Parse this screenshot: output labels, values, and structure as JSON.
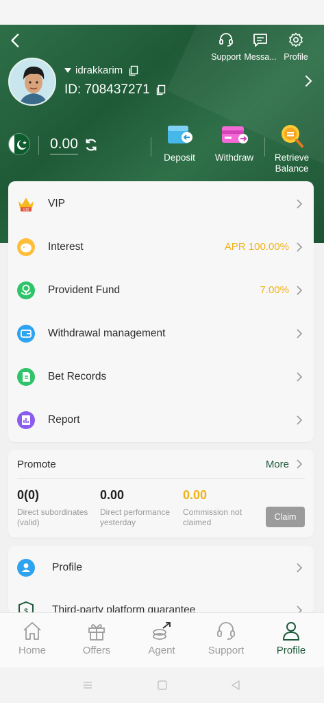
{
  "header": {
    "top_actions": [
      {
        "label": "Support",
        "icon": "headset-icon"
      },
      {
        "label": "Messa...",
        "icon": "message-icon"
      },
      {
        "label": "Profile",
        "icon": "gear-icon"
      }
    ],
    "username": "idrakkarim",
    "user_id": "ID: 708437271",
    "balance": "0.00",
    "quick_actions": [
      {
        "label": "Deposit",
        "icon": "wallet-deposit-icon"
      },
      {
        "label": "Withdraw",
        "icon": "card-withdraw-icon"
      },
      {
        "label": "Retrieve Balance",
        "icon": "coin-search-icon"
      }
    ]
  },
  "menu": [
    {
      "label": "VIP",
      "value": "",
      "icon": "vip-crown-icon"
    },
    {
      "label": "Interest",
      "value": "APR 100.00%",
      "icon": "piggy-bank-icon"
    },
    {
      "label": "Provident Fund",
      "value": "7.00%",
      "icon": "fund-icon"
    },
    {
      "label": "Withdrawal management",
      "value": "",
      "icon": "wallet-icon"
    },
    {
      "label": "Bet Records",
      "value": "",
      "icon": "document-icon"
    },
    {
      "label": "Report",
      "value": "",
      "icon": "report-chart-icon"
    }
  ],
  "promote": {
    "title": "Promote",
    "more": "More",
    "stats": [
      {
        "value": "0(0)",
        "label": "Direct subordinates (valid)",
        "color": "#222222"
      },
      {
        "value": "0.00",
        "label": "Direct performance yesterday",
        "color": "#222222"
      },
      {
        "value": "0.00",
        "label": "Commission not claimed",
        "color": "#f0b21a"
      }
    ],
    "claim": "Claim"
  },
  "profile_card": [
    {
      "label": "Profile",
      "icon": "user-icon"
    },
    {
      "label": "Third-party platform guarantee",
      "icon": "shield-dollar-icon"
    }
  ],
  "nav": [
    {
      "label": "Home",
      "icon": "home-icon"
    },
    {
      "label": "Offers",
      "icon": "gift-icon"
    },
    {
      "label": "Agent",
      "icon": "agent-icon"
    },
    {
      "label": "Support",
      "icon": "headset-icon"
    },
    {
      "label": "Profile",
      "icon": "user-icon"
    }
  ],
  "colors": {
    "primary": "#1e5a3a",
    "accent": "#f0b21a"
  }
}
